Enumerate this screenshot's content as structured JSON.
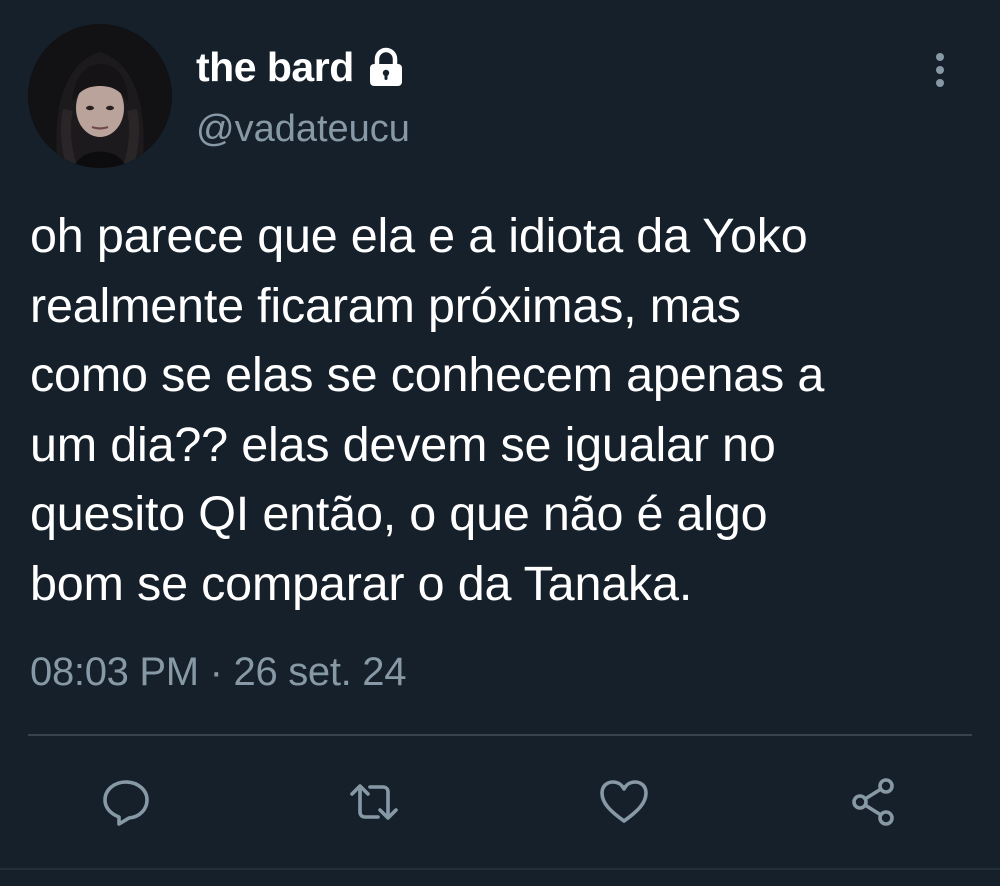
{
  "user": {
    "display_name": "the bard",
    "handle": "@vadateucu",
    "protected": true,
    "avatar": "profile-photo"
  },
  "tweet": {
    "text": "oh parece que ela e a idiota da Yoko\nrealmente ficaram próximas, mas\ncomo se elas se conhecem apenas a\num dia?? elas devem se igualar no\nquesito QI então, o que não é algo\nbom se comparar o da Tanaka.",
    "time": "08:03 PM",
    "separator": "·",
    "date": "26 set. 24"
  },
  "actions": [
    {
      "name": "reply",
      "icon": "reply-icon"
    },
    {
      "name": "retweet",
      "icon": "retweet-icon"
    },
    {
      "name": "like",
      "icon": "heart-icon"
    },
    {
      "name": "share",
      "icon": "share-icon"
    }
  ],
  "icons": {
    "more": "more-vertical-icon",
    "lock": "lock-icon"
  },
  "colors": {
    "background": "#15202b",
    "text": "#ffffff",
    "secondary_text": "#8899a6",
    "divider": "#38444d"
  }
}
